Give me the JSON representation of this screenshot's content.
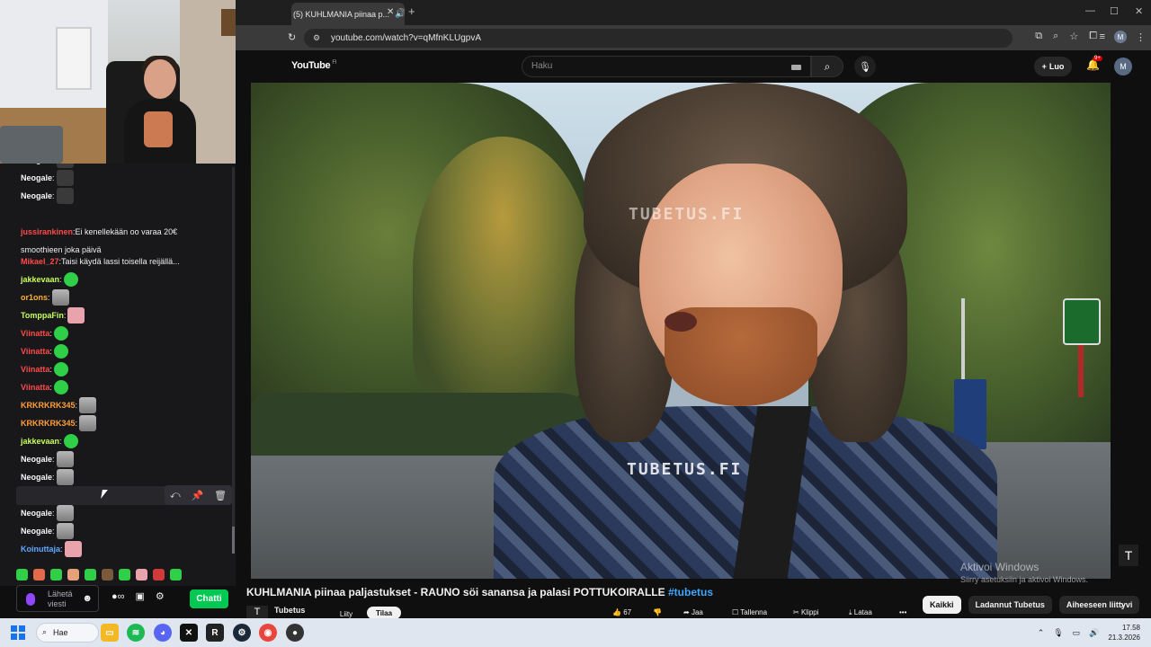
{
  "browser": {
    "tab_title": "(5) KUHLMANIA piinaa p...",
    "url": "youtube.com/watch?v=qMfnKLUgpvA",
    "profile_initial": "M"
  },
  "youtube": {
    "logo": "YouTube",
    "region": "FI",
    "search_placeholder": "Haku",
    "create_label": "Luo",
    "notifications": "9+",
    "avatar_initial": "M",
    "video_title": "KUHLMANIA piinaa paljastukset - RAUNO söi sanansa ja palasi POTTUKOIRALLE",
    "video_hashtag": "#tubetus",
    "channel_name": "Tubetus",
    "join_label": "Liity",
    "subscribe_label": "Tilaa",
    "likes": "67",
    "share_label": "Jaa",
    "save_label": "Tallenna",
    "clip_label": "Klippi",
    "download_label": "Lataa",
    "chips": [
      "Kaikki",
      "Ladannut Tubetus",
      "Aiheeseen liittyvi"
    ],
    "watermark_top": "TUBETUS.FI",
    "watermark_bottom": "TUBETUS.FI",
    "activate_title": "Aktivoi Windows",
    "activate_sub": "Siirry asetuksiin ja aktivoi Windows."
  },
  "chat": {
    "messages": [
      {
        "user": "Neogale",
        "color": "#f8f8f8",
        "text": "",
        "emote": "dark"
      },
      {
        "user": "Neogale",
        "color": "#f8f8f8",
        "text": "",
        "emote": "dark"
      },
      {
        "user": "Neogale",
        "color": "#f8f8f8",
        "text": "",
        "emote": "dark"
      },
      {
        "user": "jussirankinen",
        "color": "#ff4a4a",
        "text": "Ei kenellekään oo varaa 20€",
        "emote": ""
      },
      {
        "user": "",
        "color": "#efeff1",
        "text": "smoothieen joka päivä",
        "emote": ""
      },
      {
        "user": "Mikael_27",
        "color": "#ff4a4a",
        "text": "Taisi käydä lassi toisella reijällä...",
        "emote": ""
      },
      {
        "user": "jakkevaan",
        "color": "#c8ff5a",
        "text": "",
        "emote": "frog"
      },
      {
        "user": "or1ons",
        "color": "#ffb02e",
        "text": "",
        "emote": "cat"
      },
      {
        "user": "TomppaFin",
        "color": "#c8ff5a",
        "text": "",
        "emote": "pink"
      },
      {
        "user": "Viinatta",
        "color": "#ff4a4a",
        "text": "",
        "emote": "frog"
      },
      {
        "user": "Viinatta",
        "color": "#ff4a4a",
        "text": "",
        "emote": "frog"
      },
      {
        "user": "Viinatta",
        "color": "#ff4a4a",
        "text": "",
        "emote": "frog"
      },
      {
        "user": "Viinatta",
        "color": "#ff4a4a",
        "text": "",
        "emote": "frog"
      },
      {
        "user": "KRKRKRK345",
        "color": "#ff9f3a",
        "text": "",
        "emote": "cat"
      },
      {
        "user": "KRKRKRK345",
        "color": "#ff9f3a",
        "text": "",
        "emote": "cat"
      },
      {
        "user": "jakkevaan",
        "color": "#c8ff5a",
        "text": "",
        "emote": "frog"
      },
      {
        "user": "Neogale",
        "color": "#f8f8f8",
        "text": "",
        "emote": "cat"
      },
      {
        "user": "Neogale",
        "color": "#f8f8f8",
        "text": "",
        "emote": "cat"
      },
      {
        "user": "Neogale",
        "color": "#f8f8f8",
        "text": "",
        "emote": "cat"
      },
      {
        "user": "Neogale",
        "color": "#f8f8f8",
        "text": "",
        "emote": "cat"
      },
      {
        "user": "Neogale",
        "color": "#f8f8f8",
        "text": "",
        "emote": "cat"
      },
      {
        "user": "Koinuttaja",
        "color": "#5fa8ff",
        "text": "",
        "emote": "pink"
      }
    ],
    "input_placeholder": "Lähetä viesti",
    "send_label": "Chatti"
  },
  "taskbar": {
    "search_label": "Hae",
    "time": "17.58",
    "date": "21.3.2026"
  },
  "colors": {
    "accent_green": "#00c853",
    "twitch_purple": "#9147ff",
    "yt_red": "#cc0000",
    "link_blue": "#3ea6ff"
  }
}
